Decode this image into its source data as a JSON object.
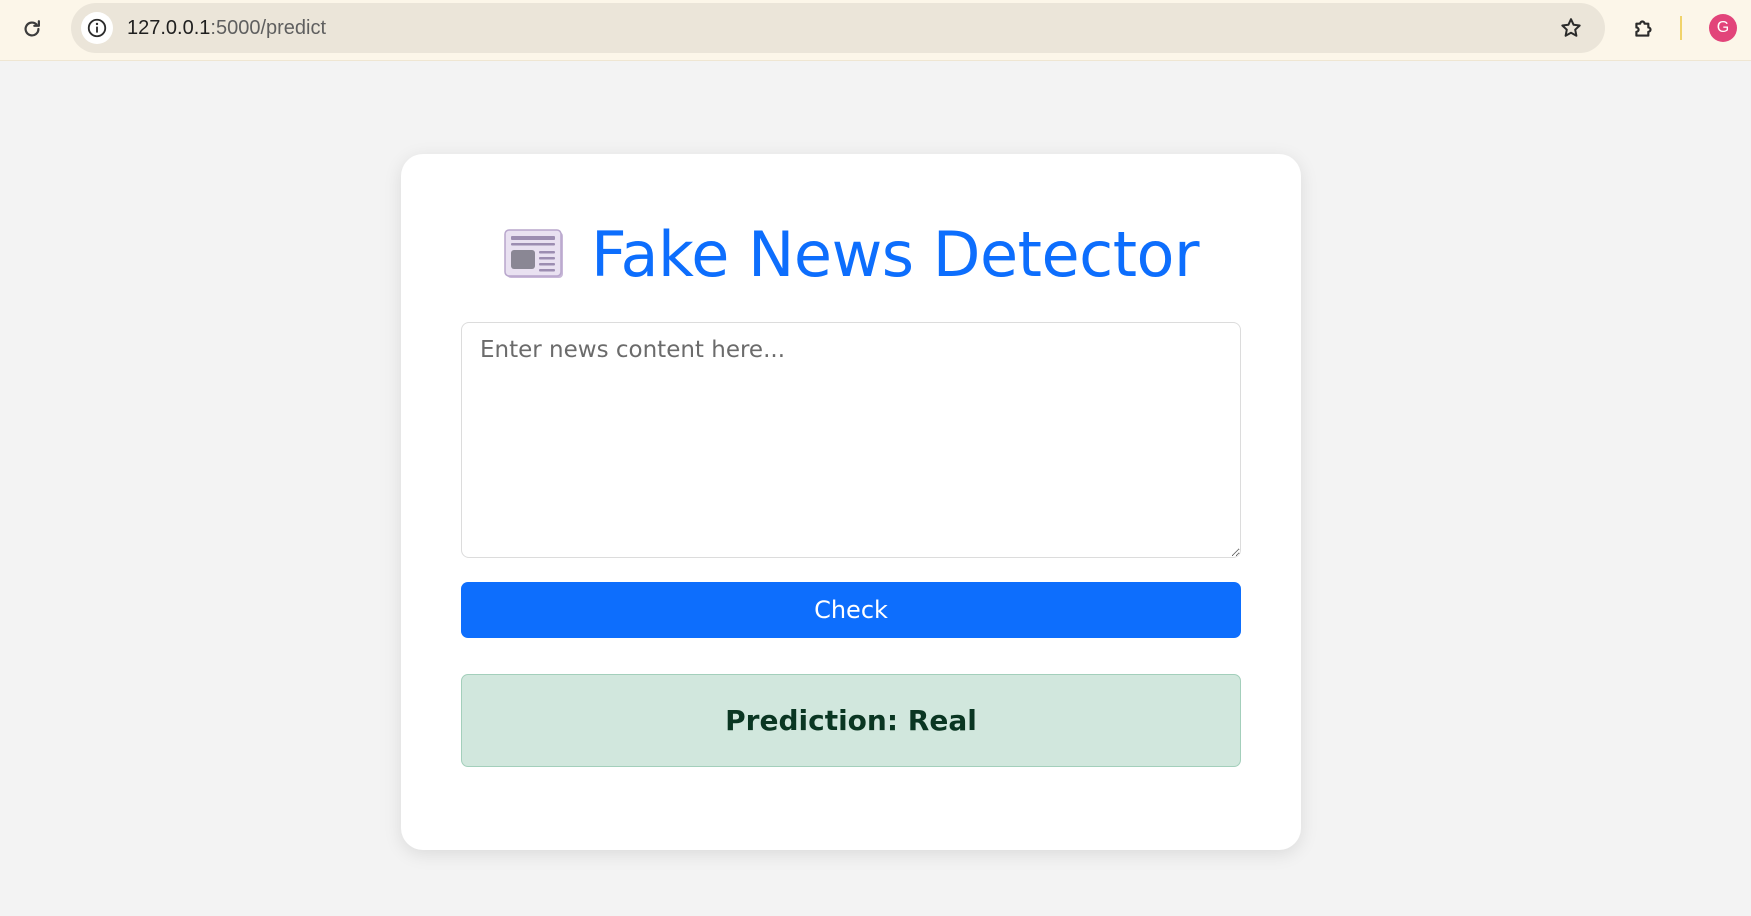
{
  "browser": {
    "url_host": "127.0.0.1",
    "url_path": ":5000/predict",
    "profile_initial": "G"
  },
  "main": {
    "title": "Fake News Detector",
    "title_icon": "newspaper-icon",
    "textarea_placeholder": "Enter news content here...",
    "check_label": "Check",
    "prediction_text": "Prediction: Real"
  },
  "colors": {
    "accent": "#0d6efd",
    "success_bg": "#d1e7dd",
    "success_text": "#0a3622"
  }
}
